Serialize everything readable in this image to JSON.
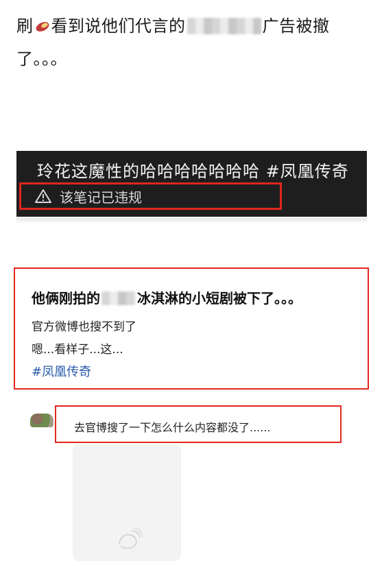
{
  "post": {
    "text_part1": "刷",
    "text_part2": "看到说他们代言的",
    "text_part3": "广告被撤",
    "text_part4": "了。。。"
  },
  "banner": {
    "title": "玲花这魔性的哈哈哈哈哈哈哈 #凤凰传奇",
    "violation_label": "该笔记已违规"
  },
  "card": {
    "title_part1": "他俩刚拍的",
    "title_part2": "冰淇淋的小短剧被下了。。。",
    "line1": "官方微博也搜不到了",
    "line2": "嗯...看样子...这...",
    "hashtag": "#凤凰传奇"
  },
  "comment": {
    "text": "去官博搜了一下怎么什么内容都没了......"
  },
  "icons": {
    "sweet_potato": "sweet-potato-emoji-icon",
    "warning": "warning-triangle-icon",
    "image_placeholder": "image-placeholder-icon"
  },
  "colors": {
    "highlight_red": "#e0261f",
    "hashtag_blue": "#2a5caa",
    "banner_bg": "#1e1e1e"
  }
}
